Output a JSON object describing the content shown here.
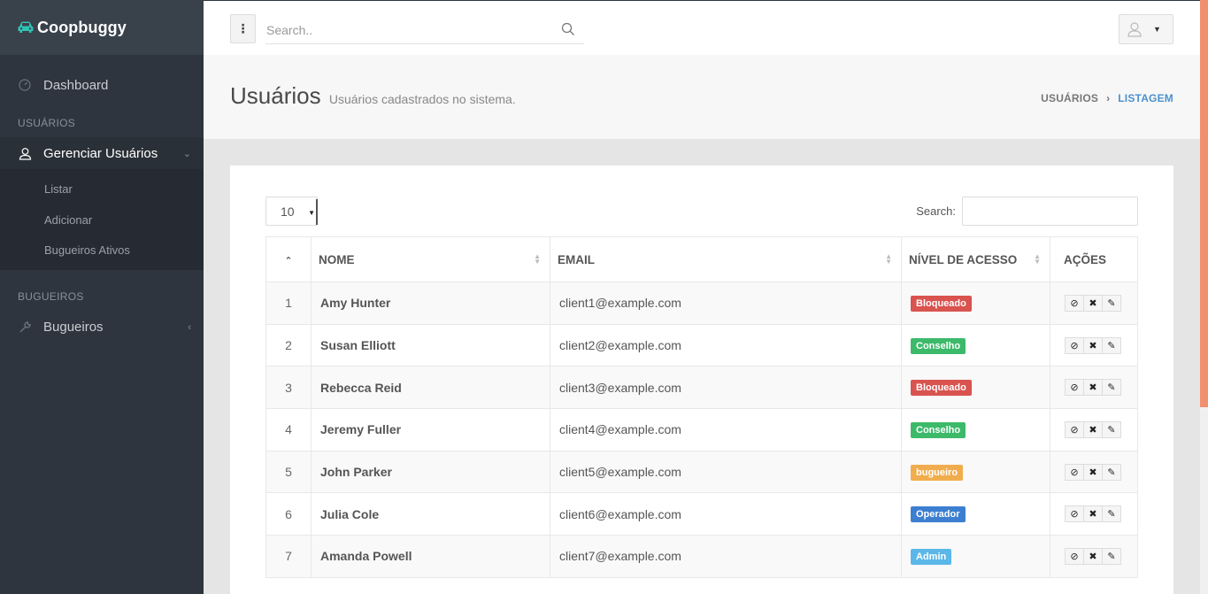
{
  "brand": {
    "name": "Coopbuggy",
    "icon": "car-icon",
    "icon_color": "#2ec4b6"
  },
  "sidebar": {
    "dashboard": {
      "label": "Dashboard",
      "icon": "dashboard-icon"
    },
    "section_users": "USUÁRIOS",
    "manage_users": {
      "label": "Gerenciar Usuários",
      "icon": "user-icon"
    },
    "sub_items": [
      {
        "label": "Listar"
      },
      {
        "label": "Adicionar"
      },
      {
        "label": "Bugueiros Ativos"
      }
    ],
    "section_buggy": "BUGUEIROS",
    "bugueiros": {
      "label": "Bugueiros",
      "icon": "wrench-icon"
    }
  },
  "topbar": {
    "search_placeholder": "Search.."
  },
  "page": {
    "title": "Usuários",
    "subtitle": "Usuários cadastrados no sistema.",
    "breadcrumb": [
      "USUÁRIOS",
      "LISTAGEM"
    ]
  },
  "table_controls": {
    "page_length": "10",
    "search_label": "Search:"
  },
  "table": {
    "columns": [
      "",
      "NOME",
      "EMAIL",
      "NÍVEL DE ACESSO",
      "AÇÕES"
    ],
    "rows": [
      {
        "id": "1",
        "name": "Amy Hunter",
        "email": "client1@example.com",
        "level": "Bloqueado",
        "color": "#d9534f"
      },
      {
        "id": "2",
        "name": "Susan Elliott",
        "email": "client2@example.com",
        "level": "Conselho",
        "color": "#3cba6a"
      },
      {
        "id": "3",
        "name": "Rebecca Reid",
        "email": "client3@example.com",
        "level": "Bloqueado",
        "color": "#d9534f"
      },
      {
        "id": "4",
        "name": "Jeremy Fuller",
        "email": "client4@example.com",
        "level": "Conselho",
        "color": "#3cba6a"
      },
      {
        "id": "5",
        "name": "John Parker",
        "email": "client5@example.com",
        "level": "bugueiro",
        "color": "#f0ad4e"
      },
      {
        "id": "6",
        "name": "Julia Cole",
        "email": "client6@example.com",
        "level": "Operador",
        "color": "#3c7fd1"
      },
      {
        "id": "7",
        "name": "Amanda Powell",
        "email": "client7@example.com",
        "level": "Admin",
        "color": "#5bb7e8"
      }
    ]
  }
}
